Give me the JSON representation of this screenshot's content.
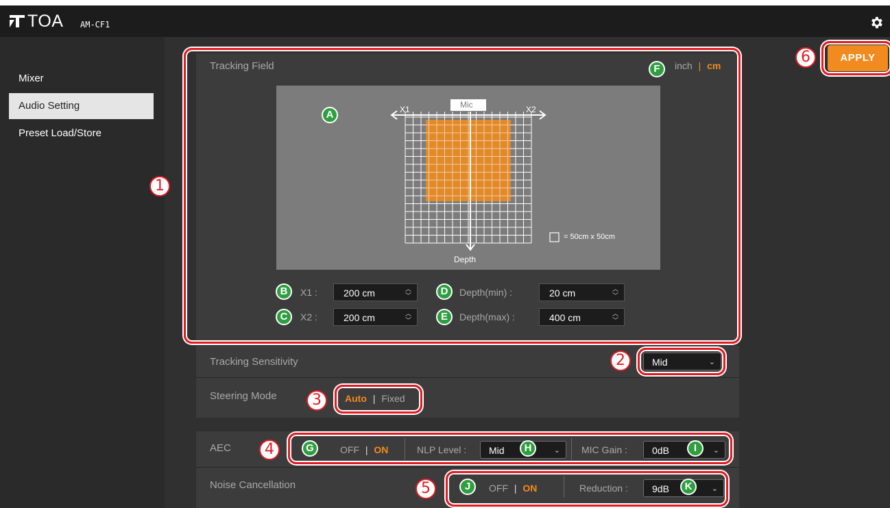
{
  "header": {
    "brand": "TOA",
    "model": "AM-CF1"
  },
  "sidebar": {
    "items": [
      {
        "label": "Mixer",
        "active": false
      },
      {
        "label": "Audio Setting",
        "active": true
      },
      {
        "label": "Preset Load/Store",
        "active": false
      }
    ]
  },
  "apply_label": "APPLY",
  "tracking_field": {
    "title": "Tracking Field",
    "unit_inch": "inch",
    "unit_sep": "|",
    "unit_cm": "cm",
    "selected_unit": "cm",
    "diagram": {
      "mic_label": "Mic",
      "x1_label": "X1",
      "x2_label": "X2",
      "depth_label": "Depth",
      "legend_text": "= 50cm x 50cm"
    },
    "x1": {
      "label": "X1 :",
      "value": "200 cm"
    },
    "x2": {
      "label": "X2 :",
      "value": "200 cm"
    },
    "depth_min": {
      "label": "Depth(min) :",
      "value": "20 cm"
    },
    "depth_max": {
      "label": "Depth(max) :",
      "value": "400 cm"
    }
  },
  "tracking_sensitivity": {
    "label": "Tracking Sensitivity",
    "value": "Mid"
  },
  "steering_mode": {
    "label": "Steering Mode",
    "auto": "Auto",
    "sep": "|",
    "fixed": "Fixed",
    "selected": "Auto"
  },
  "aec": {
    "label": "AEC",
    "off": "OFF",
    "sep": "|",
    "on": "ON",
    "selected": "ON",
    "nlp_label": "NLP Level :",
    "nlp_value": "Mid",
    "mic_gain_label": "MIC Gain :",
    "mic_gain_value": "0dB"
  },
  "noise_cancellation": {
    "label": "Noise Cancellation",
    "off": "OFF",
    "sep": "|",
    "on": "ON",
    "selected": "ON",
    "reduction_label": "Reduction :",
    "reduction_value": "9dB"
  },
  "callouts": {
    "n1": "1",
    "n2": "2",
    "n3": "3",
    "n4": "4",
    "n5": "5",
    "n6": "6",
    "A": "A",
    "B": "B",
    "C": "C",
    "D": "D",
    "E": "E",
    "F": "F",
    "G": "G",
    "H": "H",
    "I": "I",
    "J": "J",
    "K": "K"
  },
  "colors": {
    "accent": "#f18a1f",
    "callout_red": "#e31b23",
    "badge_green": "#2e9e3f",
    "tracking_area": "#e88a26"
  }
}
